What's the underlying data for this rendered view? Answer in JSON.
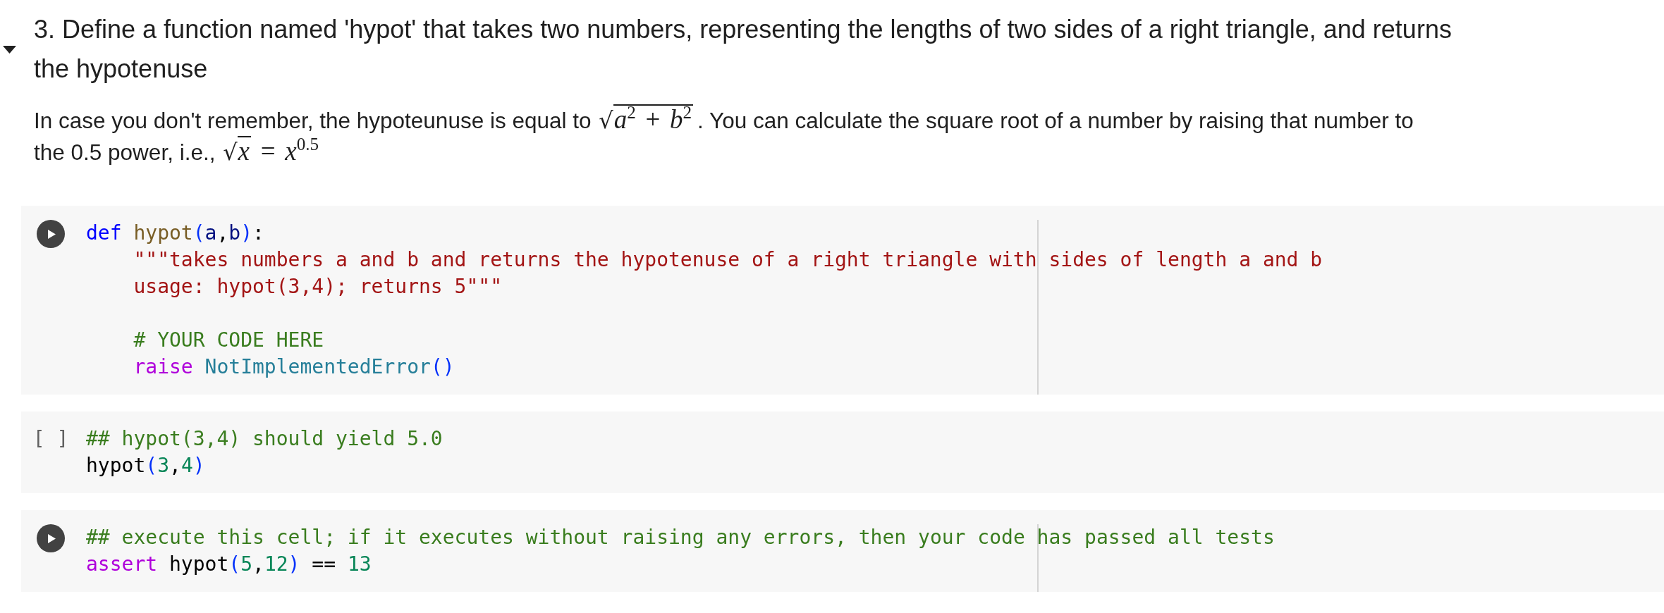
{
  "section": {
    "expanded": true,
    "heading": "3. Define a function named 'hypot' that takes two numbers, representing the lengths of two sides of a right triangle, and returns the hypotenuse",
    "paragraph": [
      {
        "kind": "text",
        "text": "In case you don't remember, the hypoteunuse is equal to "
      },
      {
        "kind": "math",
        "radical": "√",
        "radicand": "*a*$^{2}$ + *b*$^{2}$"
      },
      {
        "kind": "text",
        "text": ". You can calculate the square root of a number by raising that number to the 0.5 power, i.e., "
      },
      {
        "kind": "math",
        "radical": "√",
        "radicand": "*x*",
        "text": " = *x*$^{0.5}$"
      }
    ]
  },
  "cells": [
    {
      "prompt": {
        "kind": "run_button"
      },
      "ruler": true,
      "lines": [
        {
          "kind": "code",
          "indented": false,
          "tokens": [
            {
              "kind": "keyword",
              "text": "def "
            },
            {
              "kind": "function",
              "text": "hypot"
            },
            {
              "kind": "bracket",
              "text": "("
            },
            {
              "kind": "param",
              "text": "a"
            },
            {
              "kind": "punct",
              "text": ","
            },
            {
              "kind": "param",
              "text": "b"
            },
            {
              "kind": "bracket",
              "text": ")"
            },
            {
              "kind": "punct",
              "text": ":"
            }
          ]
        },
        {
          "kind": "code",
          "indented": true,
          "tokens": [
            {
              "kind": "string",
              "text": "\"\"\"takes numbers a and b and returns the hypotenuse of a right triangle with sides of length a and b"
            }
          ]
        },
        {
          "kind": "code",
          "indented": true,
          "tokens": [
            {
              "kind": "string",
              "text": "usage: hypot(3,4); returns 5\"\"\""
            }
          ]
        },
        {
          "kind": "blank"
        },
        {
          "kind": "code",
          "indented": true,
          "tokens": [
            {
              "kind": "comment",
              "text": "# YOUR CODE HERE"
            }
          ]
        },
        {
          "kind": "code",
          "indented": true,
          "tokens": [
            {
              "kind": "control",
              "text": "raise "
            },
            {
              "kind": "class",
              "text": "NotImplementedError"
            },
            {
              "kind": "bracket",
              "text": "()"
            }
          ]
        }
      ]
    },
    {
      "prompt": {
        "kind": "count",
        "text": "[ ]"
      },
      "ruler": false,
      "lines": [
        {
          "kind": "code",
          "indented": false,
          "tokens": [
            {
              "kind": "comment",
              "text": "## hypot(3,4) should yield 5.0"
            }
          ]
        },
        {
          "kind": "code",
          "indented": false,
          "tokens": [
            {
              "kind": "plain",
              "text": "hypot"
            },
            {
              "kind": "bracket",
              "text": "("
            },
            {
              "kind": "number",
              "text": "3"
            },
            {
              "kind": "punct",
              "text": ","
            },
            {
              "kind": "number",
              "text": "4"
            },
            {
              "kind": "bracket",
              "text": ")"
            }
          ]
        }
      ]
    },
    {
      "prompt": {
        "kind": "run_button"
      },
      "ruler": true,
      "lines": [
        {
          "kind": "code",
          "indented": false,
          "tokens": [
            {
              "kind": "comment",
              "text": "## execute this cell; if it executes without raising any errors, then your code has passed all tests"
            }
          ]
        },
        {
          "kind": "code",
          "indented": false,
          "tokens": [
            {
              "kind": "control",
              "text": "assert "
            },
            {
              "kind": "plain",
              "text": "hypot"
            },
            {
              "kind": "bracket",
              "text": "("
            },
            {
              "kind": "number",
              "text": "5"
            },
            {
              "kind": "punct",
              "text": ","
            },
            {
              "kind": "number",
              "text": "12"
            },
            {
              "kind": "bracket",
              "text": ")"
            },
            {
              "kind": "plain",
              "text": " == "
            },
            {
              "kind": "number",
              "text": "13"
            }
          ]
        }
      ]
    }
  ]
}
